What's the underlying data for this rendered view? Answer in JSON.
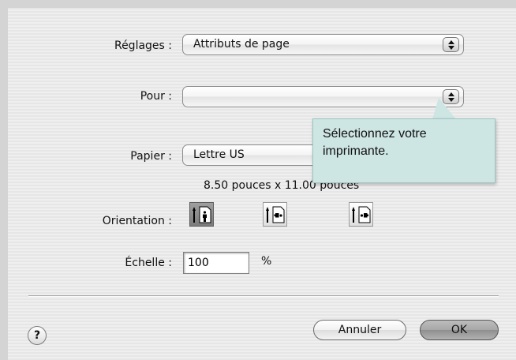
{
  "settings": {
    "label": "Réglages :",
    "value": "Attributs de page"
  },
  "format_for": {
    "label": "Pour :",
    "value": ""
  },
  "tooltip": {
    "text": "Sélectionnez votre imprimante."
  },
  "paper": {
    "label": "Papier :",
    "value": "Lettre US",
    "size_text": "8.50 pouces x 11.00 pouces"
  },
  "orientation": {
    "label": "Orientation :",
    "options": [
      {
        "icon": "portrait-orientation-icon",
        "selected": true
      },
      {
        "icon": "landscape-left-orientation-icon",
        "selected": false
      },
      {
        "icon": "landscape-right-orientation-icon",
        "selected": false
      }
    ]
  },
  "scale": {
    "label": "Échelle :",
    "value": "100",
    "unit": "%"
  },
  "buttons": {
    "help": "?",
    "cancel": "Annuler",
    "ok": "OK"
  },
  "colors": {
    "tooltip_bg": "#cde5e3",
    "window_bg": "#ececec"
  }
}
